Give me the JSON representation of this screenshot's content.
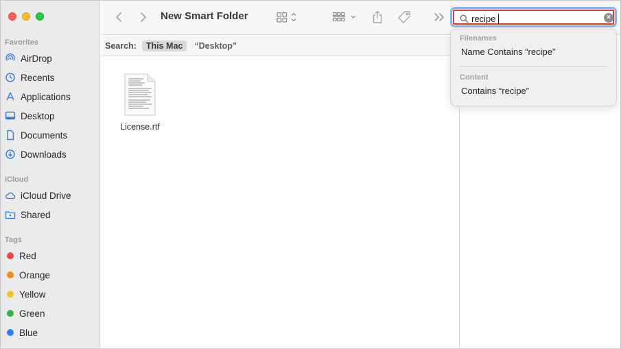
{
  "window": {
    "title": "New Smart Folder"
  },
  "sidebar": {
    "favorites_label": "Favorites",
    "favorites": [
      {
        "label": "AirDrop",
        "icon": "airdrop-icon"
      },
      {
        "label": "Recents",
        "icon": "clock-icon"
      },
      {
        "label": "Applications",
        "icon": "applications-icon"
      },
      {
        "label": "Desktop",
        "icon": "desktop-icon"
      },
      {
        "label": "Documents",
        "icon": "document-icon"
      },
      {
        "label": "Downloads",
        "icon": "download-icon"
      }
    ],
    "icloud_label": "iCloud",
    "icloud": [
      {
        "label": "iCloud Drive",
        "icon": "cloud-icon"
      },
      {
        "label": "Shared",
        "icon": "shared-folder-icon"
      }
    ],
    "tags_label": "Tags",
    "tags": [
      {
        "label": "Red",
        "color": "#ee4343"
      },
      {
        "label": "Orange",
        "color": "#f08a1c"
      },
      {
        "label": "Yellow",
        "color": "#f5c518"
      },
      {
        "label": "Green",
        "color": "#34b44a"
      },
      {
        "label": "Blue",
        "color": "#2d7ff0"
      }
    ]
  },
  "search": {
    "value": "recipe",
    "scope_label": "Search:",
    "scope_selected": "This Mac",
    "scope_other": "“Desktop”"
  },
  "suggestions": {
    "filenames_header": "Filenames",
    "filenames_item": "Name Contains “recipe”",
    "content_header": "Content",
    "content_item": "Contains “recipe”"
  },
  "files": [
    {
      "name": "License.rtf"
    }
  ],
  "accent": "#8ab4e8"
}
